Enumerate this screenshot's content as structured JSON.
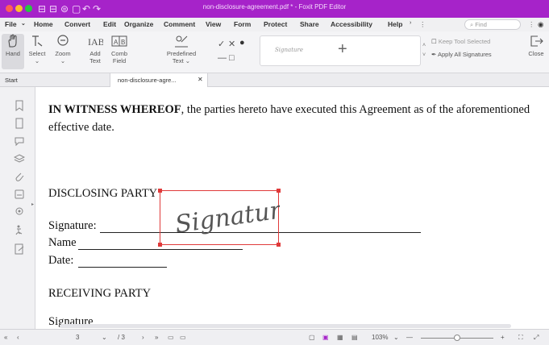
{
  "window": {
    "title": "non-disclosure-agreement.pdf * - Foxit PDF Editor"
  },
  "menu": [
    "File",
    "Home",
    "Convert",
    "Edit",
    "Organize",
    "Comment",
    "View",
    "Form",
    "Protect",
    "Share",
    "Accessibility",
    "Help"
  ],
  "search": {
    "placeholder": "Find"
  },
  "toolbar": {
    "hand": "Hand",
    "select": "Select",
    "zoom": "Zoom",
    "add_text_1": "Add",
    "add_text_2": "Text",
    "comb_1": "Comb",
    "comb_2": "Field",
    "predefined_1": "Predefined",
    "predefined_2": "Text",
    "signature_thumb": "Signature",
    "keep_tool": "Keep Tool Selected",
    "apply_all": "Apply All Signatures",
    "close": "Close"
  },
  "tabs": {
    "start": "Start",
    "doc": "non-disclosure-agre..."
  },
  "document": {
    "witness_bold": "IN WITNESS WHEREOF",
    "witness_rest": ", the parties hereto have executed this Agreement as of the aforementioned",
    "witness_line2": "effective date.",
    "disclosing": "DISCLOSING PARTY",
    "signature_label": "Signature:",
    "name_label": "Name",
    "date_label": "Date:",
    "receiving": "RECEIVING PARTY",
    "signature_label2": "Signature",
    "signature_image_text": "Signature"
  },
  "status": {
    "page": "3",
    "total": "/ 3",
    "zoom": "103%"
  },
  "colors": {
    "titlebar": "#a623c9",
    "signature_box": "#e03a3a"
  }
}
